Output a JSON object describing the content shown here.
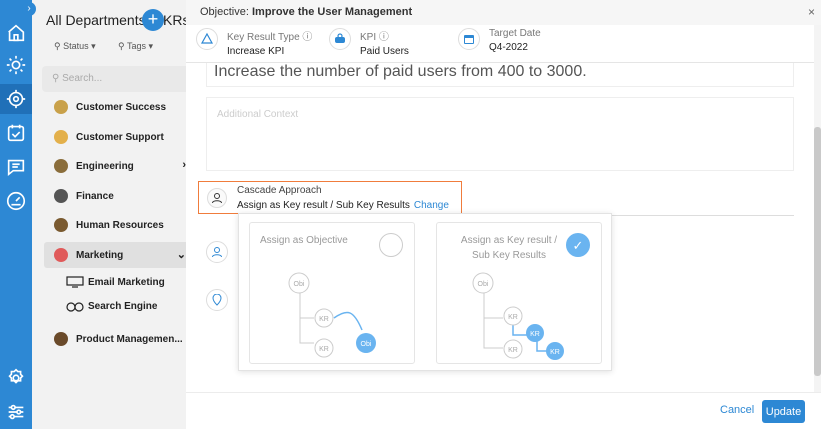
{
  "panel": {
    "title": "All Departments' OKRs",
    "add_label": "+",
    "collapse_label": "›",
    "filters": [
      {
        "label": "Status ▾"
      },
      {
        "label": "Tags ▾"
      }
    ],
    "search_placeholder": "Search...",
    "departments": [
      {
        "label": "Customer Success",
        "color": "#c9a14a"
      },
      {
        "label": "Customer Support",
        "color": "#e3b04b"
      },
      {
        "label": "Engineering",
        "color": "#8a6d3b",
        "chevron": "›"
      },
      {
        "label": "Finance",
        "color": "#555555"
      },
      {
        "label": "Human Resources",
        "color": "#7a5a30"
      },
      {
        "label": "Marketing",
        "color": "#e05a5a",
        "chevron": "⌄"
      },
      {
        "label": "Product Managemen...",
        "color": "#6a4a2a"
      }
    ],
    "sub_items": [
      {
        "label": "Email Marketing"
      },
      {
        "label": "Search Engine"
      }
    ]
  },
  "header": {
    "objective_prefix": "Objective:",
    "objective_title": "Improve the User Management",
    "close_label": "×"
  },
  "meta": {
    "kr_type_label": "Key Result Type ⓘ",
    "kr_type_value": "Increase KPI",
    "kpi_label": "KPI ⓘ",
    "kpi_value": "Paid Users",
    "target_label": "Target Date",
    "target_value": "Q4-2022"
  },
  "description": "Increase the number of paid users from 400 to 3000.",
  "context_placeholder": "Additional Context",
  "cascade": {
    "label": "Cascade Approach",
    "value": "Assign as Key result / Sub Key Results",
    "change_label": "Change"
  },
  "popup": {
    "option_objective_title": "Assign as Objective",
    "option_kr_title": "Assign as Key result / Sub Key Results",
    "node_obj": "Obi",
    "node_kr": "KR",
    "check": "✓"
  },
  "footer": {
    "cancel_label": "Cancel",
    "update_label": "Update"
  },
  "colors": {
    "accent": "#2d88d4",
    "highlight_border": "#f07c3c",
    "node_fill": "#6ab4f0"
  }
}
